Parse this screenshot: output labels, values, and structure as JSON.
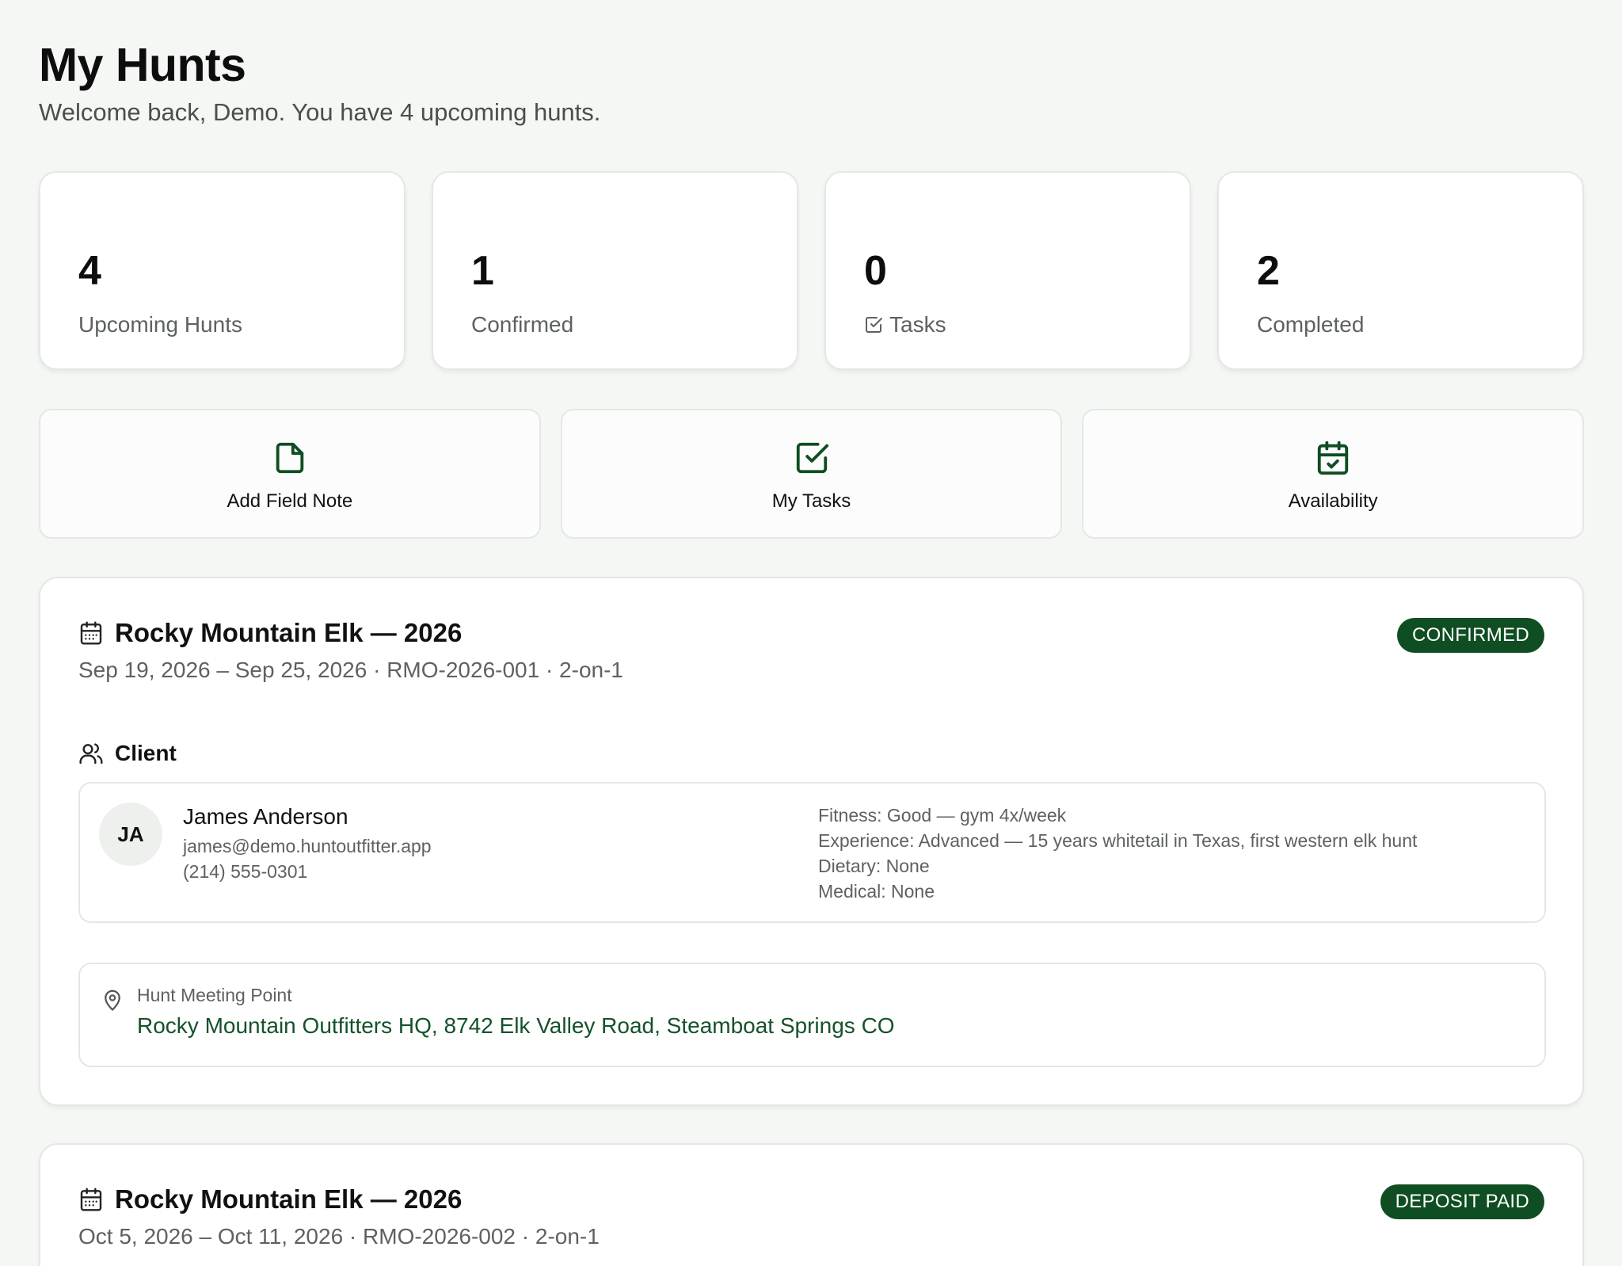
{
  "header": {
    "title": "My Hunts",
    "subtitle": "Welcome back, Demo. You have 4 upcoming hunts."
  },
  "stats": [
    {
      "value": "4",
      "label": "Upcoming Hunts"
    },
    {
      "value": "1",
      "label": "Confirmed"
    },
    {
      "value": "0",
      "label": "Tasks",
      "icon": "check-square-icon"
    },
    {
      "value": "2",
      "label": "Completed"
    }
  ],
  "actions": [
    {
      "label": "Add Field Note",
      "icon": "file-icon"
    },
    {
      "label": "My Tasks",
      "icon": "check-square-icon"
    },
    {
      "label": "Availability",
      "icon": "calendar-check-icon"
    }
  ],
  "hunts": [
    {
      "title": "Rocky Mountain Elk — 2026",
      "meta": "Sep 19, 2026 – Sep 25, 2026 · RMO-2026-001 · 2-on-1",
      "status": "CONFIRMED",
      "client_section_label": "Client",
      "client": {
        "initials": "JA",
        "name": "James Anderson",
        "email": "james@demo.huntoutfitter.app",
        "phone": "(214) 555-0301",
        "fitness": "Fitness: Good — gym 4x/week",
        "experience": "Experience: Advanced — 15 years whitetail in Texas, first western elk hunt",
        "dietary": "Dietary: None",
        "medical": "Medical: None"
      },
      "meeting": {
        "label": "Hunt Meeting Point",
        "address": "Rocky Mountain Outfitters HQ, 8742 Elk Valley Road, Steamboat Springs CO"
      }
    },
    {
      "title": "Rocky Mountain Elk — 2026",
      "meta": "Oct 5, 2026 – Oct 11, 2026 · RMO-2026-002 · 2-on-1",
      "status": "DEPOSIT PAID"
    }
  ],
  "colors": {
    "accent": "#0f4d22",
    "background": "#f5f7f5",
    "muted_text": "#5d625f"
  }
}
